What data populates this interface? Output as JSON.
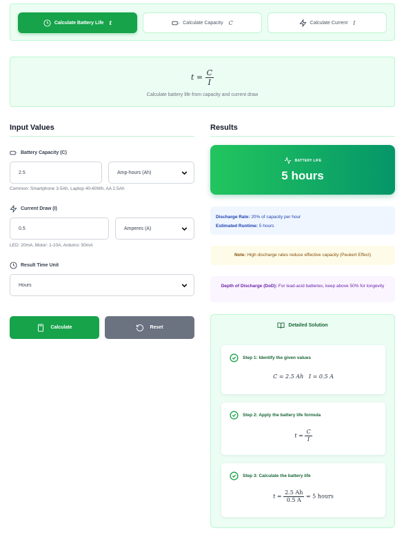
{
  "tabs": [
    {
      "label": "Calculate Battery Life",
      "symbol": "t",
      "active": true,
      "icon": "clock-icon"
    },
    {
      "label": "Calculate Capacity",
      "symbol": "C",
      "active": false,
      "icon": "battery-icon"
    },
    {
      "label": "Calculate Current",
      "symbol": "I",
      "active": false,
      "icon": "zap-icon"
    }
  ],
  "formula": {
    "lhs": "t =",
    "numerator": "C",
    "denominator": "I",
    "description": "Calculate battery life from capacity and current draw"
  },
  "input": {
    "title": "Input Values",
    "capacity": {
      "label": "Battery Capacity (C)",
      "value": "2.5",
      "unit": "Amp-hours (Ah)",
      "hint": "Common: Smartphone 3-5Ah, Laptop 40-60Wh, AA 2.5Ah"
    },
    "current": {
      "label": "Current Draw (I)",
      "value": "0.5",
      "unit": "Amperes (A)",
      "hint": "LED: 20mA, Motor: 1-10A, Arduino: 50mA"
    },
    "time_unit": {
      "label": "Result Time Unit",
      "value": "Hours"
    },
    "calculate_label": "Calculate",
    "reset_label": "Reset"
  },
  "results": {
    "title": "Results",
    "card_label": "BATTERY LIFE",
    "card_value": "5 hours",
    "discharge_rate_label": "Discharge Rate:",
    "discharge_rate_value": "20% of capacity per hour",
    "runtime_label": "Estimated Runtime:",
    "runtime_value": "5 hours",
    "note_label": "Note:",
    "note_text": "High discharge rates reduce effective capacity (Peukert Effect)",
    "dod_label": "Depth of Discharge (DoD):",
    "dod_text": "For lead-acid batteries, keep above 50% for longevity"
  },
  "solution": {
    "title": "Detailed Solution",
    "steps": [
      {
        "title": "Step 1: Identify the given values",
        "math_a": "C = 2.5 Ah",
        "math_b": "I = 0.5 A"
      },
      {
        "title": "Step 2: Apply the battery life formula",
        "lhs": "t =",
        "numerator": "C",
        "denominator": "I"
      },
      {
        "title": "Step 3: Calculate the battery life",
        "lhs": "t =",
        "numerator": "2.5 Ah",
        "denominator": "0.5 A",
        "rhs": "= 5 hours"
      }
    ]
  },
  "colors": {
    "accent": "#16a34a",
    "panel_bg": "#ecfdf3",
    "reset_button": "#6b7280"
  }
}
